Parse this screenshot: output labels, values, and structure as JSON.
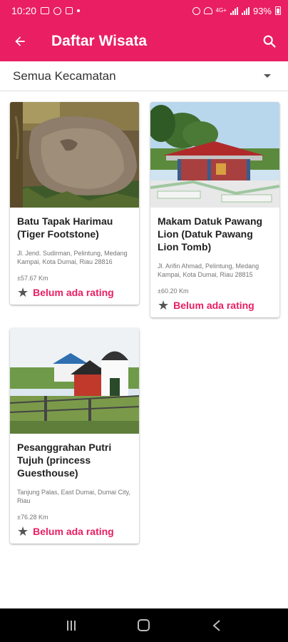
{
  "status_bar": {
    "time": "10:20",
    "network_label": "4G+",
    "battery": "93%"
  },
  "app_bar": {
    "title": "Daftar Wisata",
    "back_icon": "arrow-left-icon",
    "search_icon": "search-icon"
  },
  "filter": {
    "selected": "Semua Kecamatan"
  },
  "places": [
    {
      "name": "Batu Tapak Harimau (Tiger Footstone)",
      "address": "Jl. Jend. Sudirman, Pelintung, Medang Kampai, Kota Dumai, Riau 28816",
      "distance": "±57.67 Km",
      "rating": "Belum ada rating"
    },
    {
      "name": "Makam Datuk Pawang Lion (Datuk Pawang Lion Tomb)",
      "address": "Jl. Arifin Ahmad, Pelintung, Medang Kampai, Kota Dumai, Riau 28815",
      "distance": "±60.20 Km",
      "rating": "Belum ada rating"
    },
    {
      "name": "Pesanggrahan Putri Tujuh (princess Guesthouse)",
      "address": "Tanjung Palas, East Dumai, Dumai City, Riau",
      "distance": "±76.28 Km",
      "rating": "Belum ada rating"
    }
  ],
  "colors": {
    "primary": "#e91e63",
    "star": "#555555"
  }
}
